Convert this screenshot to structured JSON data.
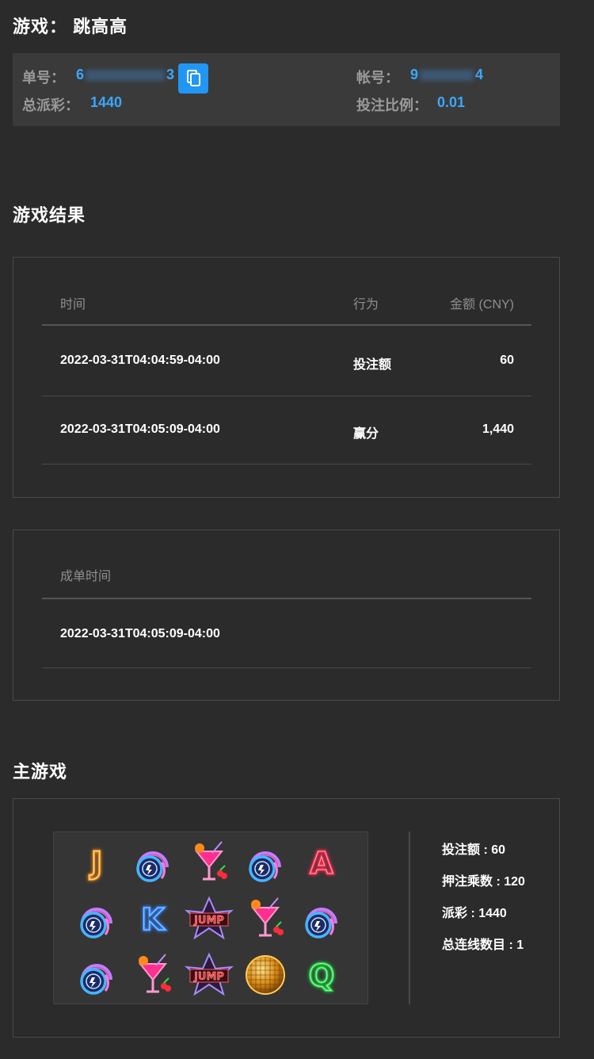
{
  "header": {
    "title": "游戏： 跳高高"
  },
  "order": {
    "order_label": "单号：",
    "order_prefix": "6",
    "order_suffix": "3",
    "account_label": "帐号：",
    "account_prefix": "9",
    "account_suffix": "4",
    "payout_label": "总派彩：",
    "payout_value": "1440",
    "ratio_label": "投注比例：",
    "ratio_value": "0.01"
  },
  "results": {
    "title": "游戏结果",
    "columns": {
      "time": "时间",
      "action": "行为",
      "amount": "金额 (CNY)"
    },
    "rows": [
      {
        "time": "2022-03-31T04:04:59-04:00",
        "action": "投注额",
        "amount": "60"
      },
      {
        "time": "2022-03-31T04:05:09-04:00",
        "action": "赢分",
        "amount": "1,440"
      }
    ]
  },
  "settlement": {
    "column": "成单时间",
    "value": "2022-03-31T04:05:09-04:00"
  },
  "main_game": {
    "title": "主游戏",
    "symbols": [
      [
        "J",
        "headphones",
        "cocktail",
        "headphones",
        "A"
      ],
      [
        "headphones",
        "K",
        "jump",
        "cocktail",
        "headphones"
      ],
      [
        "headphones",
        "cocktail",
        "jump",
        "disco-ball",
        "Q"
      ]
    ],
    "stats": [
      "投注额 : 60",
      "押注乘数 : 120",
      "派彩 : 1440",
      "总连线数目 : 1"
    ],
    "colors": {
      "J": "#ff9a1a",
      "K": "#2e86ff",
      "A": "#ff2a4e",
      "Q": "#22dd44",
      "accent": "#3aa7ff"
    }
  }
}
